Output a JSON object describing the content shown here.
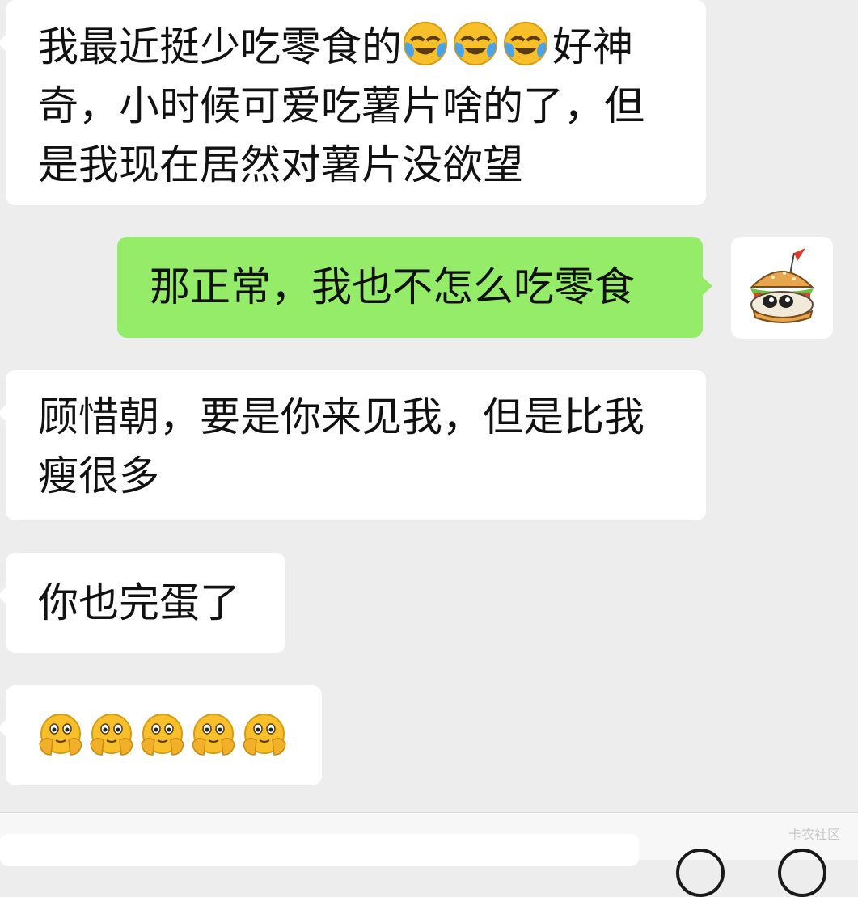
{
  "messages": [
    {
      "text_before": "我最近挺少吃零食的",
      "emoji": "face-with-tears-of-joy",
      "emoji_count": 3,
      "text_after": "好神奇，小时候可爱吃薯片啥的了，但是我现在居然对薯片没欲望"
    },
    {
      "text": "那正常，我也不怎么吃零食"
    },
    {
      "text": "顾惜朝，要是你来见我，但是比我瘦很多"
    },
    {
      "text": "你也完蛋了"
    },
    {
      "emoji": "shy-face-with-hands",
      "emoji_count": 5
    }
  ],
  "avatar": {
    "icon": "hamburger-cat-sticker"
  },
  "watermark": "卡农社区",
  "colors": {
    "background": "#ededed",
    "incoming": "#ffffff",
    "outgoing": "#95ec69",
    "text": "#111111"
  }
}
